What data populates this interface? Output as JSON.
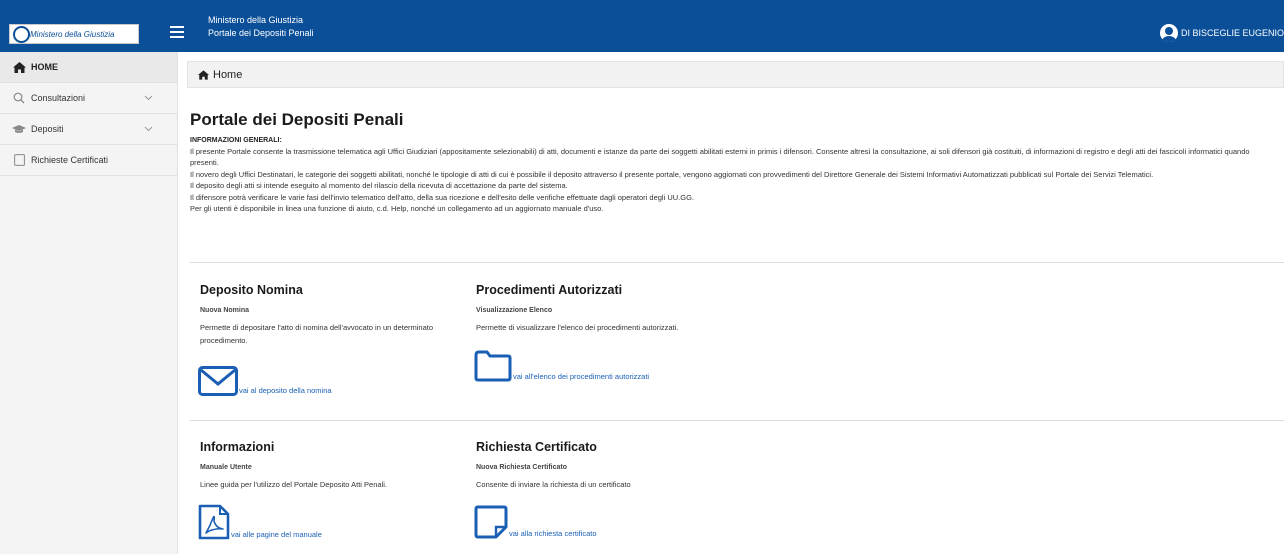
{
  "header": {
    "logo_text": "Ministero della Giustizia",
    "title_line1": "Ministero della Giustizia",
    "title_line2": "Portale dei Depositi Penali",
    "user_name": "DI BISCEGLIE EUGENIO",
    "bg_color": "#0b4f98"
  },
  "sidebar": {
    "items": [
      {
        "label": "HOME",
        "icon": "home-icon",
        "active": true
      },
      {
        "label": "Consultazioni",
        "icon": "search-icon",
        "expandable": true
      },
      {
        "label": "Depositi",
        "icon": "graduation-cap-icon",
        "expandable": true
      },
      {
        "label": "Richieste Certificati",
        "icon": "document-icon"
      }
    ]
  },
  "breadcrumb": {
    "label": "Home"
  },
  "main": {
    "title": "Portale dei Depositi Penali",
    "info_heading": "INFORMAZIONI GENERALI:",
    "info_paragraphs": [
      "Il presente Portale consente la trasmissione telematica agli Uffici Giudiziari (appositamente selezionabili) di atti, documenti e istanze da parte dei soggetti abilitati esterni in primis i difensori. Consente altresì la consultazione, ai soli difensori già costituiti, di informazioni di registro e degli atti dei fascicoli informatici quando presenti.",
      "Il novero degli Uffici Destinatari, le categorie dei soggetti abilitati, nonché le tipologie di atti di cui è possibile il deposito attraverso il presente portale, vengono aggiornati con provvedimenti del Direttore Generale dei Sistemi Informativi Automatizzati pubblicati sul Portale dei Servizi Telematici.",
      "Il deposito degli atti si intende eseguito al momento del rilascio della ricevuta di accettazione da parte del sistema.",
      "Il difensore potrà verificare le varie fasi dell'invio telematico dell'atto, della sua ricezione e dell'esito delle verifiche effettuate dagli operatori degli UU.GG.",
      "Per gli utenti è disponibile in linea una funzione di aiuto, c.d. Help, nonché un collegamento ad un aggiornato manuale d'uso."
    ],
    "cards": [
      {
        "title": "Deposito Nomina",
        "subtitle": "Nuova Nomina",
        "description": "Permette di depositare l'atto di nomina dell'avvocato in un determinato procedimento.",
        "link": "vai al deposito della nomina",
        "icon": "envelope-icon"
      },
      {
        "title": "Procedimenti Autorizzati",
        "subtitle": "Visualizzazione Elenco",
        "description": "Permette di visualizzare l'elenco dei procedimenti autorizzati.",
        "link": "vai all'elenco dei procedimenti autorizzati",
        "icon": "folder-icon"
      },
      {
        "title": "Informazioni",
        "subtitle": "Manuale Utente",
        "description": "Linee guida per l'utilizzo del Portale Deposito Atti Penali.",
        "link": "vai alle pagine del manuale",
        "icon": "pdf-icon"
      },
      {
        "title": "Richiesta Certificato",
        "subtitle": "Nuova Richiesta Certificato",
        "description": "Consente di inviare la richiesta di un certificato",
        "link": "vai alla richiesta certificato",
        "icon": "note-icon"
      }
    ],
    "link_color": "#1a5fb4"
  }
}
